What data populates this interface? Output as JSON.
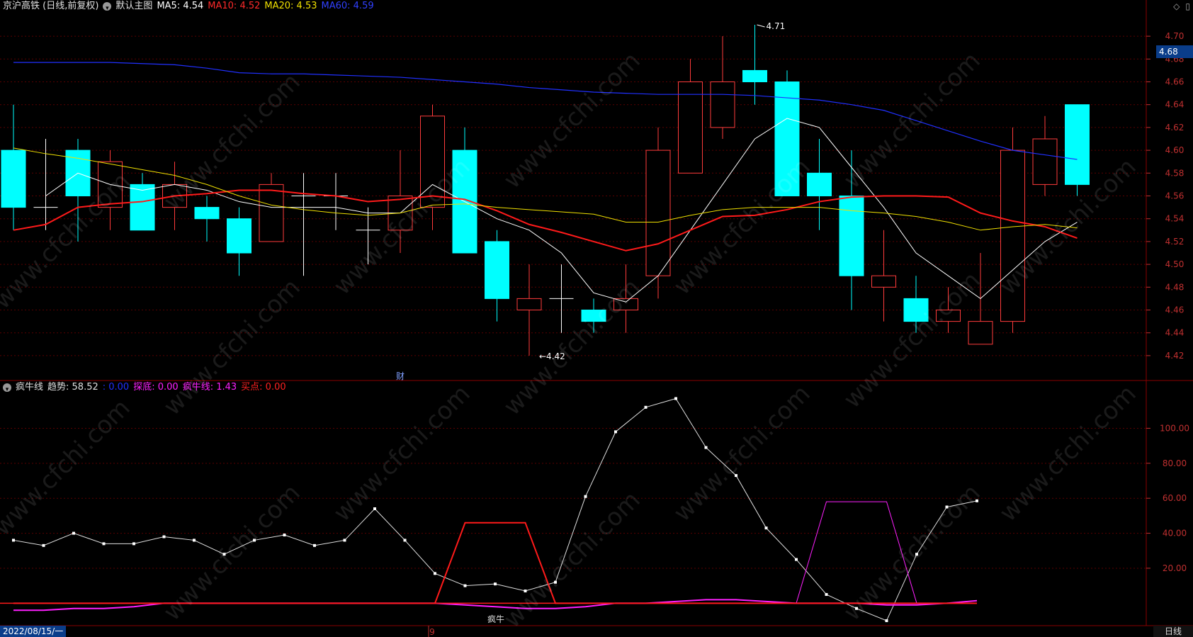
{
  "header_top": {
    "stock": "京沪高铁 (日线,前复权)",
    "main_chart": "默认主图",
    "ma5": "MA5: 4.54",
    "ma10": "MA10: 4.52",
    "ma20": "MA20: 4.53",
    "ma60": "MA60: 4.59"
  },
  "header_bottom": {
    "name": "疯牛线",
    "trend": "趋势: 58.52",
    "blue": ": 0.00",
    "probe": "探底: 0.00",
    "crazy_bull": "疯牛线: 1.43",
    "buy": "买点: 0.00"
  },
  "colors": {
    "up": "#ff3b3b",
    "down": "#00ffff",
    "ma5": "#ffffff",
    "ma10": "#ff1a1a",
    "ma20": "#f0e000",
    "ma60": "#2030ff",
    "ind_line": "#e0e0e0",
    "ind_red": "#ff1a1a",
    "ind_magenta": "#ff20ff",
    "grid": "#5a0000",
    "axis_text": "#c03030"
  },
  "current_price_label": "4.68",
  "date_label": "2022/08/15/一",
  "period_label": "日线",
  "month_marker": "9",
  "finance_marker": "财",
  "signal_label": "疯牛",
  "high_label": "4.71",
  "low_label": "4.42",
  "watermark_text": "www.cfchi.com",
  "chart_data": [
    {
      "type": "candlestick",
      "title": "京沪高铁 (日线,前复权)",
      "y_ticks": [
        "4.70",
        "4.68",
        "4.66",
        "4.64",
        "4.62",
        "4.60",
        "4.58",
        "4.56",
        "4.54",
        "4.52",
        "4.50",
        "4.48",
        "4.46",
        "4.44",
        "4.42"
      ],
      "ylim": [
        4.41,
        4.71
      ],
      "candles": [
        {
          "o": 4.6,
          "h": 4.64,
          "l": 4.53,
          "c": 4.55
        },
        {
          "o": 4.55,
          "h": 4.61,
          "l": 4.53,
          "c": 4.55
        },
        {
          "o": 4.6,
          "h": 4.61,
          "l": 4.52,
          "c": 4.56
        },
        {
          "o": 4.55,
          "h": 4.6,
          "l": 4.53,
          "c": 4.59
        },
        {
          "o": 4.57,
          "h": 4.58,
          "l": 4.53,
          "c": 4.53
        },
        {
          "o": 4.55,
          "h": 4.59,
          "l": 4.53,
          "c": 4.57
        },
        {
          "o": 4.55,
          "h": 4.56,
          "l": 4.52,
          "c": 4.54
        },
        {
          "o": 4.54,
          "h": 4.55,
          "l": 4.49,
          "c": 4.51
        },
        {
          "o": 4.52,
          "h": 4.58,
          "l": 4.52,
          "c": 4.57
        },
        {
          "o": 4.56,
          "h": 4.58,
          "l": 4.49,
          "c": 4.56
        },
        {
          "o": 4.56,
          "h": 4.58,
          "l": 4.53,
          "c": 4.56
        },
        {
          "o": 4.53,
          "h": 4.55,
          "l": 4.5,
          "c": 4.53
        },
        {
          "o": 4.53,
          "h": 4.6,
          "l": 4.51,
          "c": 4.56
        },
        {
          "o": 4.55,
          "h": 4.64,
          "l": 4.53,
          "c": 4.63
        },
        {
          "o": 4.6,
          "h": 4.62,
          "l": 4.51,
          "c": 4.51
        },
        {
          "o": 4.52,
          "h": 4.53,
          "l": 4.45,
          "c": 4.47
        },
        {
          "o": 4.46,
          "h": 4.5,
          "l": 4.42,
          "c": 4.47
        },
        {
          "o": 4.47,
          "h": 4.5,
          "l": 4.44,
          "c": 4.47
        },
        {
          "o": 4.46,
          "h": 4.47,
          "l": 4.44,
          "c": 4.45
        },
        {
          "o": 4.46,
          "h": 4.5,
          "l": 4.44,
          "c": 4.47
        },
        {
          "o": 4.49,
          "h": 4.62,
          "l": 4.47,
          "c": 4.6
        },
        {
          "o": 4.58,
          "h": 4.68,
          "l": 4.58,
          "c": 4.66
        },
        {
          "o": 4.62,
          "h": 4.7,
          "l": 4.61,
          "c": 4.66
        },
        {
          "o": 4.67,
          "h": 4.71,
          "l": 4.64,
          "c": 4.66
        },
        {
          "o": 4.66,
          "h": 4.67,
          "l": 4.56,
          "c": 4.56
        },
        {
          "o": 4.58,
          "h": 4.61,
          "l": 4.53,
          "c": 4.56
        },
        {
          "o": 4.56,
          "h": 4.6,
          "l": 4.46,
          "c": 4.49
        },
        {
          "o": 4.48,
          "h": 4.53,
          "l": 4.45,
          "c": 4.49
        },
        {
          "o": 4.47,
          "h": 4.49,
          "l": 4.44,
          "c": 4.45
        },
        {
          "o": 4.45,
          "h": 4.48,
          "l": 4.44,
          "c": 4.46
        },
        {
          "o": 4.43,
          "h": 4.51,
          "l": 4.43,
          "c": 4.45
        },
        {
          "o": 4.45,
          "h": 4.62,
          "l": 4.44,
          "c": 4.6
        },
        {
          "o": 4.57,
          "h": 4.63,
          "l": 4.56,
          "c": 4.61
        },
        {
          "o": 4.64,
          "h": 4.64,
          "l": 4.56,
          "c": 4.57
        }
      ],
      "series": [
        {
          "name": "MA5",
          "values": [
            null,
            4.56,
            4.58,
            4.57,
            4.565,
            4.57,
            4.565,
            4.555,
            4.55,
            4.55,
            4.55,
            4.545,
            4.545,
            4.57,
            4.555,
            4.54,
            4.53,
            4.51,
            4.475,
            4.467,
            4.49,
            4.53,
            4.57,
            4.61,
            4.628,
            4.62,
            4.585,
            4.55,
            4.51,
            4.49,
            4.47,
            4.495,
            4.52,
            4.537
          ]
        },
        {
          "name": "MA10",
          "values": [
            4.53,
            4.535,
            4.55,
            4.553,
            4.555,
            4.56,
            4.562,
            4.565,
            4.565,
            4.562,
            4.56,
            4.555,
            4.557,
            4.56,
            4.557,
            4.547,
            4.535,
            4.528,
            4.52,
            4.512,
            4.518,
            4.53,
            4.542,
            4.543,
            4.548,
            4.555,
            4.559,
            4.56,
            4.56,
            4.559,
            4.545,
            4.538,
            4.533,
            4.523
          ]
        },
        {
          "name": "MA20",
          "values": [
            4.602,
            4.597,
            4.593,
            4.588,
            4.583,
            4.578,
            4.57,
            4.56,
            4.552,
            4.548,
            4.545,
            4.543,
            4.545,
            4.552,
            4.553,
            4.55,
            4.548,
            4.546,
            4.544,
            4.537,
            4.537,
            4.543,
            4.548,
            4.55,
            4.55,
            4.55,
            4.547,
            4.545,
            4.542,
            4.537,
            4.53,
            4.533,
            4.535,
            4.532
          ]
        },
        {
          "name": "MA60",
          "values": [
            4.677,
            4.677,
            4.677,
            4.677,
            4.676,
            4.675,
            4.672,
            4.668,
            4.667,
            4.667,
            4.666,
            4.665,
            4.664,
            4.662,
            4.66,
            4.658,
            4.655,
            4.653,
            4.651,
            4.65,
            4.649,
            4.649,
            4.649,
            4.648,
            4.646,
            4.644,
            4.64,
            4.635,
            4.626,
            4.617,
            4.608,
            4.6,
            4.596,
            4.592
          ]
        }
      ]
    },
    {
      "type": "line",
      "title": "疯牛线",
      "y_ticks": [
        "100.00",
        "80.00",
        "60.00",
        "40.00",
        "20.00"
      ],
      "ylim": [
        -10,
        118
      ],
      "series": [
        {
          "name": "趋势",
          "values": [
            36,
            33,
            40,
            34,
            34,
            38,
            36,
            28,
            36,
            39,
            33,
            36,
            54,
            36,
            17,
            10,
            11,
            7,
            12,
            61,
            98,
            112,
            117,
            89,
            73,
            43,
            25,
            5,
            -3,
            -10,
            28,
            55,
            58.52
          ]
        },
        {
          "name": "疯牛线",
          "values": [
            -4,
            -4,
            -3,
            -3,
            -2,
            0,
            0,
            0,
            0,
            0,
            0,
            0,
            0,
            0,
            0,
            -1,
            -2,
            -3,
            -3,
            -2,
            0,
            0,
            1,
            2,
            2,
            1,
            0,
            0,
            0,
            -1,
            -1,
            0,
            1.43
          ]
        },
        {
          "name": "买点",
          "values": [
            0,
            0,
            0,
            0,
            0,
            0,
            0,
            0,
            0,
            0,
            0,
            0,
            0,
            0,
            0,
            46,
            46,
            46,
            0,
            0,
            0,
            0,
            0,
            0,
            0,
            0,
            0,
            0,
            0,
            0,
            0,
            0,
            0
          ]
        },
        {
          "name": "探底",
          "values": [
            0,
            0,
            0,
            0,
            0,
            0,
            0,
            0,
            0,
            0,
            0,
            0,
            0,
            0,
            0,
            0,
            0,
            0,
            0,
            0,
            0,
            0,
            0,
            0,
            0,
            0,
            0,
            58,
            58,
            58,
            0,
            0,
            0
          ]
        }
      ]
    }
  ]
}
